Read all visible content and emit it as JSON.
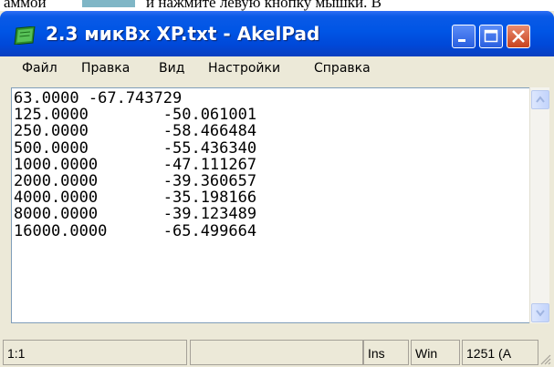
{
  "background_doc": {
    "left_text": "аммой",
    "right_text": "и нажмите левую кнопку мышки. В"
  },
  "window": {
    "title": "2.3 микВх XP.txt - AkelPad"
  },
  "menu": [
    "Файл",
    "Правка",
    "Вид",
    "Настройки",
    "Справка"
  ],
  "editor": {
    "lines": [
      "63.0000 -67.743729",
      "125.0000        -50.061001",
      "250.0000        -58.466484",
      "500.0000        -55.436340",
      "1000.0000       -47.111267",
      "2000.0000       -39.360657",
      "4000.0000       -35.198166",
      "8000.0000       -39.123489",
      "16000.0000      -65.499664"
    ]
  },
  "status": {
    "position": "1:1",
    "empty": "",
    "insert_mode": "Ins",
    "newline": "Win",
    "codepage": "1251 (A"
  },
  "icons": [
    "app-icon",
    "minimize-icon",
    "maximize-icon",
    "close-icon",
    "scroll-up-icon",
    "scroll-down-icon",
    "resize-grip-icon"
  ],
  "colors": {
    "titlebar": "#0055e5",
    "close_button": "#c8431d",
    "window_bg": "#ece9d8"
  }
}
